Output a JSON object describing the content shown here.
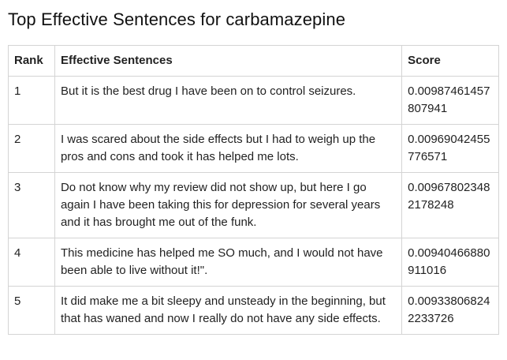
{
  "page": {
    "title": "Top Effective Sentences for carbamazepine"
  },
  "table": {
    "headers": {
      "rank": "Rank",
      "sentence": "Effective Sentences",
      "score": "Score"
    },
    "rows": [
      {
        "rank": "1",
        "sentence": "But it is the best drug I have been on to control seizures.",
        "score": "0.00987461457807941"
      },
      {
        "rank": "2",
        "sentence": "I was scared about the side effects but I had to weigh up the pros and cons and took it has helped me lots.",
        "score": "0.00969042455776571"
      },
      {
        "rank": "3",
        "sentence": "Do not know why my review did not show up, but here I go again I have been taking this for depression for several years and it has brought me out of the funk.",
        "score": "0.009678023482178248"
      },
      {
        "rank": "4",
        "sentence": "This medicine has helped me SO much, and I would not have been able to live without it!\".",
        "score": "0.00940466880911016"
      },
      {
        "rank": "5",
        "sentence": "It did make me a bit sleepy and unsteady in the beginning, but that has waned and now I really do not have any side effects.",
        "score": "0.009338068242233726"
      }
    ]
  }
}
